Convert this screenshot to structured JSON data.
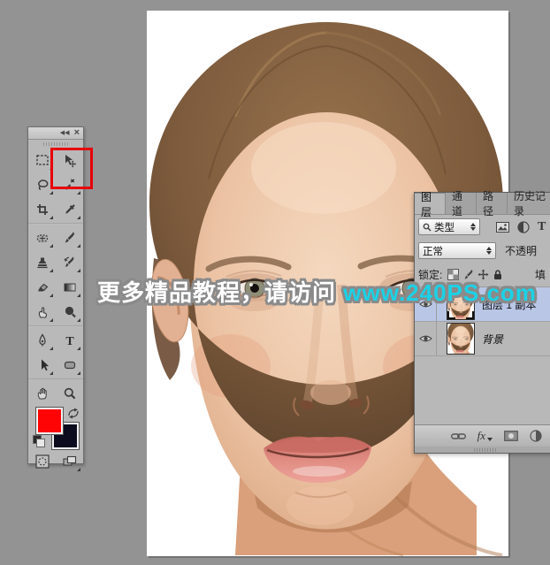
{
  "workspace": {
    "background": "#939393"
  },
  "canvas": {
    "background": "#ffffff",
    "content": "woman-face-photo"
  },
  "watermark": {
    "prefix": "更多精品教程，请访问 ",
    "link": "www.240PS.com",
    "link_color": "#1bd2e6",
    "outline_color": "#8a8a8a"
  },
  "toolbar": {
    "collapse_icon": "◀◀",
    "close_icon": "×",
    "highlighted_tool": "move",
    "highlight_color": "#e60006",
    "foreground_color": "#fe0404",
    "background_color": "#0c0c1e",
    "tools": [
      "rectangular-marquee",
      "move",
      "lasso",
      "magic-wand",
      "crop",
      "eyedropper",
      "spot-healing",
      "brush",
      "clone-stamp",
      "history-brush",
      "eraser",
      "gradient",
      "smudge",
      "dodge",
      "pen",
      "type",
      "path-selection",
      "rounded-rectangle",
      "hand",
      "zoom",
      "quick-mask",
      "screen-mode"
    ]
  },
  "layers_panel": {
    "tabs": [
      {
        "label": "图层",
        "active": true
      },
      {
        "label": "通道",
        "active": false
      },
      {
        "label": "路径",
        "active": false
      },
      {
        "label": "历史记录",
        "active": false
      }
    ],
    "filter_kind": "类型",
    "type_icon": "T",
    "blend_mode": "正常",
    "opacity_label": "不透明",
    "lock_label": "锁定:",
    "fill_label": "填",
    "fx_label": "fx",
    "selected_row_color": "#b9c6e6",
    "layers": [
      {
        "name": "图层 1 副本",
        "selected": true,
        "visible": true
      },
      {
        "name": "背景",
        "selected": false,
        "visible": true
      }
    ]
  }
}
